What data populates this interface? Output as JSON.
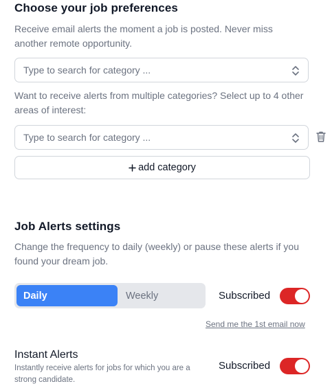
{
  "job_preferences": {
    "title": "Choose your job preferences",
    "description": "Receive email alerts the moment a job is posted. Never miss another remote opportunity.",
    "category_select_placeholder": "Type to search for category ...",
    "multi_hint": "Want to receive alerts from multiple categories? Select up to 4 other areas of interest:",
    "extra_select_placeholder": "Type to search for category ...",
    "add_category_label": "add category",
    "add_category_icon": "plus-icon",
    "remove_icon": "trash-icon"
  },
  "alerts_settings": {
    "title": "Job Alerts settings",
    "description": "Change the frequency to daily (weekly) or pause these alerts if you found your dream job.",
    "frequency_options": [
      "Daily",
      "Weekly"
    ],
    "frequency_selected": "Daily",
    "subscription_label": "Subscribed",
    "subscription_on": true,
    "send_first_email_link": "Send me the 1st email now"
  },
  "instant_alerts": {
    "title": "Instant Alerts",
    "description": "Instantly receive alerts for jobs for which you are a strong candidate.",
    "subscription_label": "Subscribed",
    "subscription_on": true
  },
  "colors": {
    "accent_blue": "#3b82f6",
    "toggle_red": "#dc2626",
    "muted_text": "#6b7280",
    "border": "#d1d5db"
  }
}
